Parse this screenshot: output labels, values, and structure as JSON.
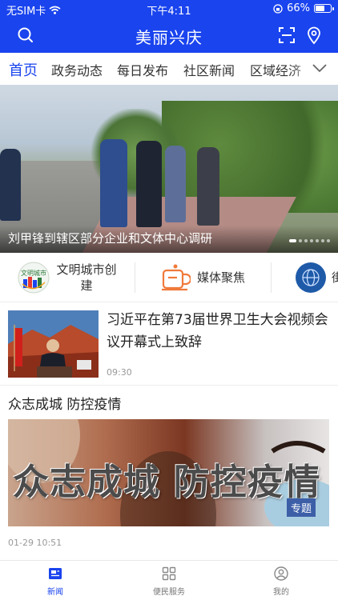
{
  "status_bar": {
    "carrier": "无SIM卡",
    "time": "下午4:11",
    "battery": "66%",
    "battery_level": 0.66
  },
  "header": {
    "title": "美丽兴庆",
    "left_icon": "search-icon",
    "right_icons": [
      "scan-icon",
      "location-icon"
    ]
  },
  "tabs": {
    "items": [
      {
        "label": "首页",
        "active": true
      },
      {
        "label": "政务动态"
      },
      {
        "label": "每日发布"
      },
      {
        "label": "社区新闻"
      },
      {
        "label": "区域经济"
      }
    ],
    "more_icon": "chevron-down-icon"
  },
  "banner": {
    "caption": "刘甲锋到辖区部分企业和文体中心调研",
    "page_count": 7,
    "current_page": 1
  },
  "quick_links": [
    {
      "label": "文明城市创建",
      "icon": "civilized-city-logo",
      "logo_text": "文明城市"
    },
    {
      "label": "媒体聚焦",
      "icon": "media-cup-icon"
    },
    {
      "label": "街",
      "icon": "globe-icon"
    }
  ],
  "news": [
    {
      "headline": "习近平在第73届世界卫生大会视频会议开幕式上致辞",
      "time": "09:30"
    },
    {
      "headline": "众志成城 防控疫情",
      "image_text": "众志成城 防控疫情",
      "tag": "专题",
      "time": "01-29 10:51"
    }
  ],
  "bottom_nav": [
    {
      "label": "新闻",
      "icon": "news-icon",
      "active": true
    },
    {
      "label": "便民服务",
      "icon": "grid-icon"
    },
    {
      "label": "我的",
      "icon": "user-icon"
    }
  ],
  "colors": {
    "brand": "#1a44ee",
    "text": "#222222",
    "muted": "#999999"
  }
}
